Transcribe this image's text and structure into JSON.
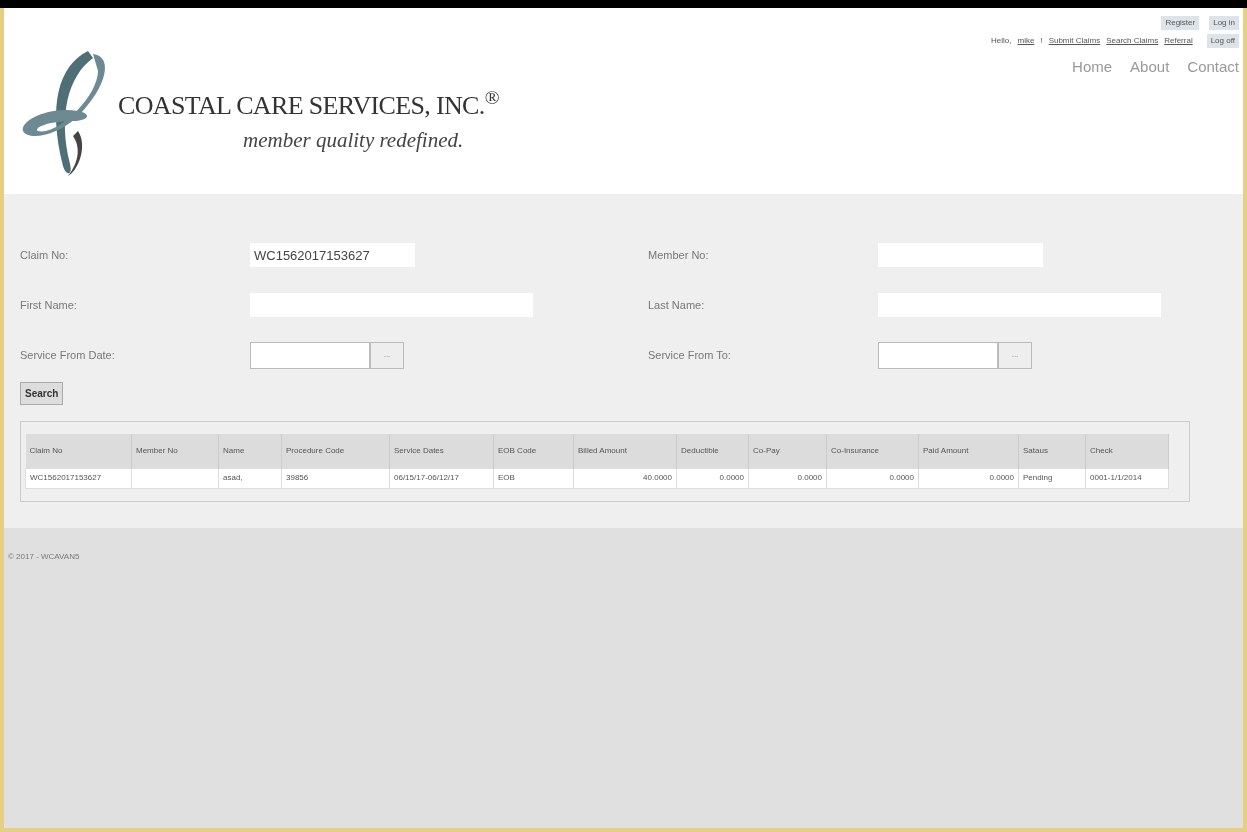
{
  "header": {
    "company": "COASTAL CARE SERVICES, INC.$^{®}$",
    "tagline": "member quality redefined.",
    "account_links": [
      {
        "label": "Register",
        "kind": "button"
      },
      {
        "label": "Log in",
        "kind": "button"
      }
    ],
    "greeting": "Hello,",
    "user": "mike",
    "separator": "!",
    "nav_links": [
      {
        "label": "Submit Claims",
        "kind": "link"
      },
      {
        "label": "Search Claims",
        "kind": "link"
      },
      {
        "label": "Referral",
        "kind": "link"
      },
      {
        "label": "Log off",
        "kind": "button"
      }
    ],
    "menu": [
      "Home",
      "About",
      "Contact"
    ]
  },
  "form": {
    "fields": [
      {
        "label": "Claim No:",
        "value": "WC1562017153627",
        "kind": "short"
      },
      {
        "label": "Member No:",
        "kind": "short"
      },
      {
        "label": "First Name:",
        "kind": "long"
      },
      {
        "label": "Last Name:",
        "kind": "long"
      },
      {
        "label": "Service From Date:",
        "kind": "date",
        "picker": "..."
      },
      {
        "label": "Service From To:",
        "kind": "date",
        "picker": "..."
      }
    ],
    "search_button": "Search"
  },
  "table": {
    "columns": [
      "Claim No",
      "Member No",
      "Name",
      "Procedure Code",
      "Service Dates",
      "EOB Code",
      "Billed Amount",
      "Deductible",
      "Co-Pay",
      "Co-Insurance",
      "Paid Amount",
      "Sataus",
      "Check"
    ],
    "rows": [
      [
        "WC1562017153627",
        "",
        "asad,",
        "39856",
        "06/15/17-06/12/17",
        "EOB",
        "40.0000",
        "0.0000",
        "0.0000",
        "0.0000",
        "0.0000",
        "Pending",
        "0001-1/1/2014"
      ]
    ]
  },
  "footer": "© 2017 - WCAVAN5"
}
